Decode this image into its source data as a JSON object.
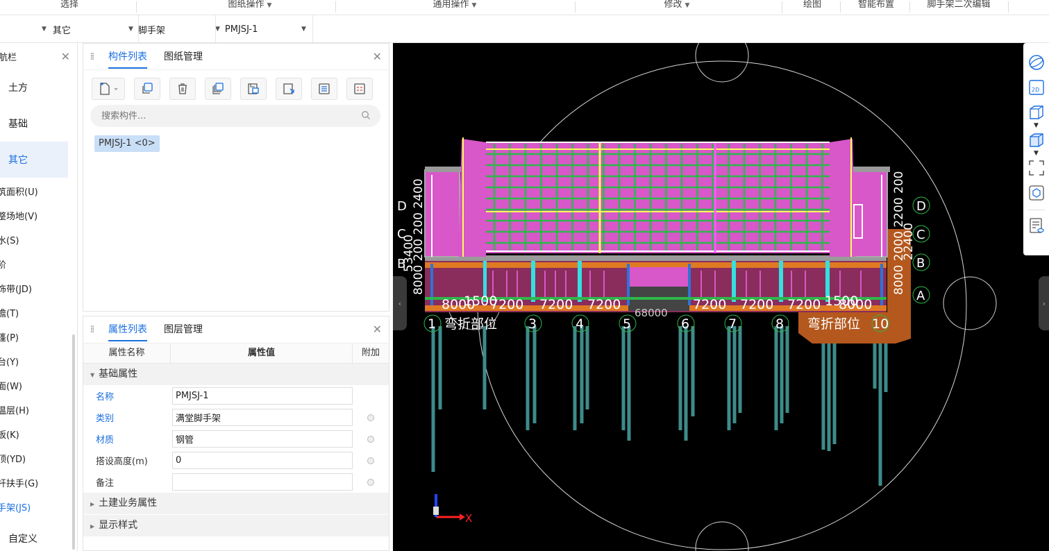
{
  "ribbon": {
    "groups": [
      {
        "label": "选择",
        "dropdown": false
      },
      {
        "label": "图纸操作",
        "dropdown": true
      },
      {
        "label": "通用操作",
        "dropdown": true
      },
      {
        "label": "修改",
        "dropdown": true
      },
      {
        "label": "绘图",
        "dropdown": false
      },
      {
        "label": "智能布置",
        "dropdown": false
      },
      {
        "label": "脚手架二次编辑",
        "dropdown": false
      }
    ]
  },
  "selectors": {
    "s1": "",
    "s2": "其它",
    "s3": "脚手架",
    "s4": "PMJSJ-1"
  },
  "nav": {
    "title": "航栏",
    "big_items": [
      "土方",
      "基础",
      "其它"
    ],
    "active_big": "其它",
    "sub_items": [
      "筑面积(U)",
      "整场地(V)",
      "水(S)",
      "阶",
      "饰带(JD)",
      "檐(T)",
      "篷(P)",
      "台(Y)",
      "面(W)",
      "温层(H)",
      "板(K)",
      "顶(YD)",
      "杆扶手(G)",
      "手架(JS)"
    ],
    "active_sub": "手架(JS)",
    "custom": "自定义"
  },
  "component_panel": {
    "tabs": [
      "构件列表",
      "图纸管理"
    ],
    "active_tab": "构件列表",
    "search_placeholder": "搜索构件...",
    "items": [
      "PMJSJ-1 <0>"
    ]
  },
  "property_panel": {
    "tabs": [
      "属性列表",
      "图层管理"
    ],
    "active_tab": "属性列表",
    "headers": {
      "name": "属性名称",
      "value": "属性值",
      "extra": "附加"
    },
    "group_basic": "基础属性",
    "rows": [
      {
        "name": "名称",
        "value": "PMJSJ-1",
        "blue": true,
        "has_extra": false
      },
      {
        "name": "类别",
        "value": "满堂脚手架",
        "blue": true,
        "has_extra": true
      },
      {
        "name": "材质",
        "value": "钢管",
        "blue": true,
        "has_extra": true
      },
      {
        "name": "搭设高度(m)",
        "value": "0",
        "blue": false,
        "has_extra": true
      },
      {
        "name": "备注",
        "value": "",
        "blue": false,
        "has_extra": true
      }
    ],
    "group_civil": "土建业务属性",
    "group_display": "显示样式"
  },
  "viewport": {
    "top_dims": [
      "8000",
      "1500",
      "7200",
      "7200",
      "7200",
      "7200",
      "7200",
      "7200",
      "1500",
      "8000"
    ],
    "hidden_dim": "68000",
    "left_dims": "8000 200 200 2400",
    "left_total": "53400",
    "right_dims": "8000 2000 2200 200",
    "right_total": "22400",
    "axis_cols": [
      "1",
      "3",
      "4",
      "5",
      "6",
      "7",
      "8",
      "10"
    ],
    "axis_rows_left": [
      "D",
      "C",
      "B"
    ],
    "axis_rows_right": [
      "D",
      "C",
      "B",
      "A"
    ],
    "bend_label": "弯折部位",
    "axis_x_label": "X"
  },
  "colors": {
    "accent": "#1a6fe0",
    "viewport_bg": "#000000",
    "slab_magenta": "#d857c9",
    "grid_green": "#2db84a",
    "orange": "#e07a22",
    "pile_teal": "#3e8b8b"
  }
}
